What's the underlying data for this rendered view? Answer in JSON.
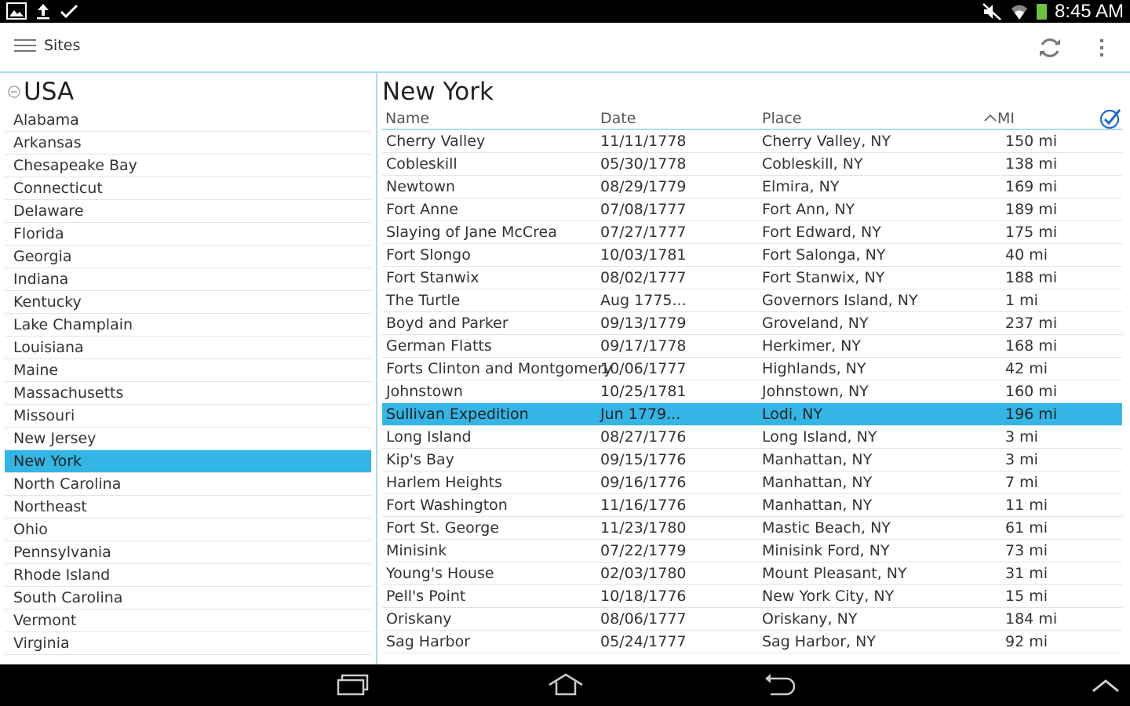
{
  "status_bar": {
    "time": "8:45 AM",
    "left_icons": [
      "image-icon",
      "upload-icon",
      "check-icon"
    ],
    "right_icons": [
      "mute-icon",
      "wifi-icon",
      "battery-icon"
    ],
    "battery_color": "#6cc13d"
  },
  "action_bar": {
    "title": "Sites",
    "accent_color": "#a9dcf2"
  },
  "left_pane": {
    "country": "USA",
    "selected_color": "#33b5e5",
    "states": [
      {
        "label": "Alabama"
      },
      {
        "label": "Arkansas"
      },
      {
        "label": "Chesapeake Bay"
      },
      {
        "label": "Connecticut"
      },
      {
        "label": "Delaware"
      },
      {
        "label": "Florida"
      },
      {
        "label": "Georgia"
      },
      {
        "label": "Indiana"
      },
      {
        "label": "Kentucky"
      },
      {
        "label": "Lake Champlain"
      },
      {
        "label": "Louisiana"
      },
      {
        "label": "Maine"
      },
      {
        "label": "Massachusetts"
      },
      {
        "label": "Missouri"
      },
      {
        "label": "New Jersey"
      },
      {
        "label": "New York",
        "selected": true
      },
      {
        "label": "North Carolina"
      },
      {
        "label": "Northeast"
      },
      {
        "label": "Ohio"
      },
      {
        "label": "Pennsylvania"
      },
      {
        "label": "Rhode Island"
      },
      {
        "label": "South Carolina"
      },
      {
        "label": "Vermont"
      },
      {
        "label": "Virginia"
      }
    ]
  },
  "right_pane": {
    "title": "New York",
    "columns": {
      "name": "Name",
      "date": "Date",
      "place": "Place",
      "mi": "MI"
    },
    "sort_column": "mi",
    "rows": [
      {
        "name": "Cherry Valley",
        "date": "11/11/1778",
        "place": "Cherry Valley, NY",
        "mi": "150 mi"
      },
      {
        "name": "Cobleskill",
        "date": "05/30/1778",
        "place": "Cobleskill, NY",
        "mi": "138 mi"
      },
      {
        "name": "Newtown",
        "date": "08/29/1779",
        "place": "Elmira, NY",
        "mi": "169 mi"
      },
      {
        "name": "Fort Anne",
        "date": "07/08/1777",
        "place": "Fort Ann, NY",
        "mi": "189 mi"
      },
      {
        "name": "Slaying of Jane McCrea",
        "date": "07/27/1777",
        "place": "Fort Edward, NY",
        "mi": "175 mi"
      },
      {
        "name": "Fort Slongo",
        "date": "10/03/1781",
        "place": "Fort Salonga, NY",
        "mi": "40 mi"
      },
      {
        "name": "Fort Stanwix",
        "date": "08/02/1777",
        "place": "Fort Stanwix, NY",
        "mi": "188 mi"
      },
      {
        "name": "The Turtle",
        "date": "Aug 1775...",
        "place": "Governors Island, NY",
        "mi": "1 mi"
      },
      {
        "name": "Boyd and Parker",
        "date": "09/13/1779",
        "place": "Groveland, NY",
        "mi": "237 mi"
      },
      {
        "name": "German Flatts",
        "date": "09/17/1778",
        "place": "Herkimer, NY",
        "mi": "168 mi"
      },
      {
        "name": "Forts Clinton and Montgomery",
        "date": "10/06/1777",
        "place": "Highlands, NY",
        "mi": "42 mi"
      },
      {
        "name": "Johnstown",
        "date": "10/25/1781",
        "place": "Johnstown, NY",
        "mi": "160 mi"
      },
      {
        "name": "Sullivan Expedition",
        "date": "Jun 1779...",
        "place": "Lodi, NY",
        "mi": "196 mi",
        "selected": true
      },
      {
        "name": "Long Island",
        "date": "08/27/1776",
        "place": "Long Island, NY",
        "mi": "3 mi"
      },
      {
        "name": "Kip's Bay",
        "date": "09/15/1776",
        "place": "Manhattan, NY",
        "mi": "3 mi"
      },
      {
        "name": "Harlem Heights",
        "date": "09/16/1776",
        "place": "Manhattan, NY",
        "mi": "7 mi"
      },
      {
        "name": "Fort Washington",
        "date": "11/16/1776",
        "place": "Manhattan, NY",
        "mi": "11 mi"
      },
      {
        "name": "Fort St. George",
        "date": "11/23/1780",
        "place": "Mastic Beach, NY",
        "mi": "61 mi"
      },
      {
        "name": "Minisink",
        "date": "07/22/1779",
        "place": "Minisink Ford, NY",
        "mi": "73 mi"
      },
      {
        "name": "Young's House",
        "date": "02/03/1780",
        "place": "Mount Pleasant, NY",
        "mi": "31 mi"
      },
      {
        "name": "Pell's Point",
        "date": "10/18/1776",
        "place": "New York City, NY",
        "mi": "15 mi"
      },
      {
        "name": "Oriskany",
        "date": "08/06/1777",
        "place": "Oriskany, NY",
        "mi": "184 mi"
      },
      {
        "name": "Sag Harbor",
        "date": "05/24/1777",
        "place": "Sag Harbor, NY",
        "mi": "92 mi"
      }
    ]
  },
  "nav_bar": {
    "buttons": [
      "recent-apps-icon",
      "home-icon",
      "back-icon",
      "chevron-up-icon"
    ]
  }
}
